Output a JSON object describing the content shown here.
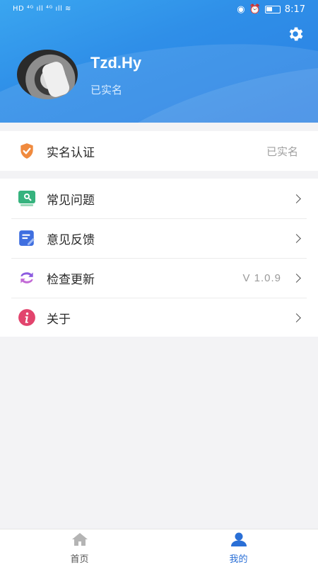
{
  "status_bar": {
    "left_text": "HD ⁴ᴳ ıll ⁴ᴳ ıll ≋",
    "time": "8:17"
  },
  "profile": {
    "username": "Tzd.Hy",
    "status": "已实名"
  },
  "verification": {
    "label": "实名认证",
    "value": "已实名",
    "icon": "shield-check-icon"
  },
  "menu": [
    {
      "label": "常见问题",
      "icon": "faq-icon"
    },
    {
      "label": "意见反馈",
      "icon": "feedback-icon"
    },
    {
      "label": "检查更新",
      "icon": "refresh-icon",
      "value": "V 1.0.9"
    },
    {
      "label": "关于",
      "icon": "info-icon"
    }
  ],
  "bottom_nav": [
    {
      "label": "首页",
      "icon": "home-icon",
      "active": false
    },
    {
      "label": "我的",
      "icon": "user-icon",
      "active": true
    }
  ],
  "colors": {
    "header_blue": "#2f8fe8",
    "active_nav": "#2a6fd6",
    "inactive_nav": "#9a9a9a"
  }
}
